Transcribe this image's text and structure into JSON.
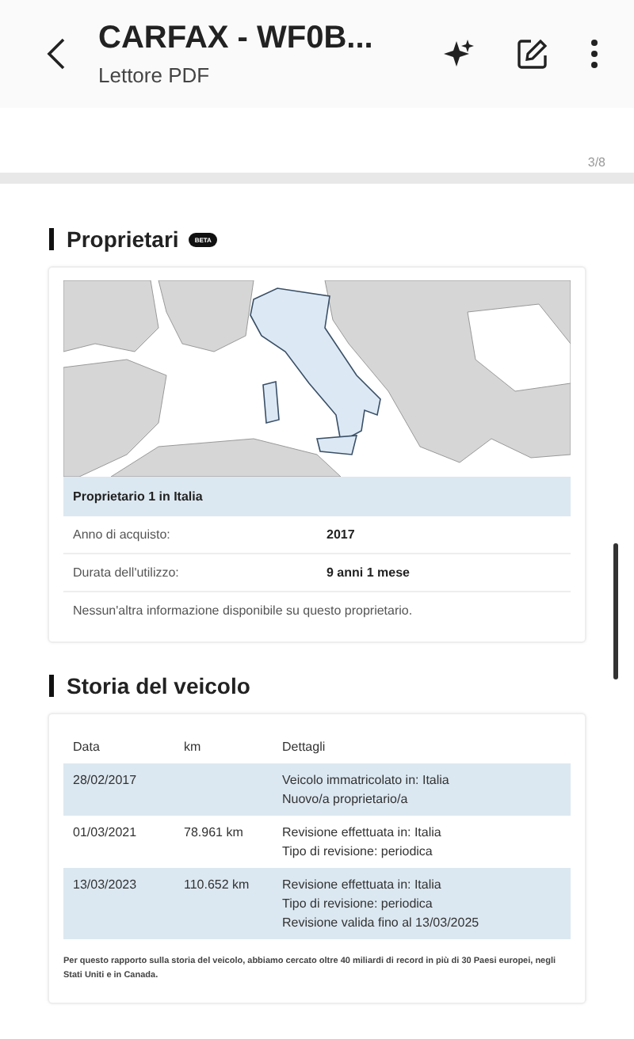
{
  "header": {
    "title": "CARFAX - WF0B...",
    "subtitle": "Lettore PDF"
  },
  "page_indicator": "3/8",
  "owners": {
    "title": "Proprietari",
    "badge": "BETA",
    "owner_heading": "Proprietario 1 in Italia",
    "rows": [
      {
        "label": "Anno di acquisto:",
        "value": "2017"
      },
      {
        "label": "Durata dell'utilizzo:",
        "value": "9 anni 1 mese"
      }
    ],
    "note": "Nessun'altra informazione disponibile su questo proprietario."
  },
  "history": {
    "title": "Storia del veicolo",
    "columns": [
      "Data",
      "km",
      "Dettagli"
    ],
    "rows": [
      {
        "date": "28/02/2017",
        "km": "",
        "details": [
          "Veicolo immatricolato in: Italia",
          "Nuovo/a proprietario/a"
        ]
      },
      {
        "date": "01/03/2021",
        "km": "78.961 km",
        "details": [
          "Revisione effettuata in: Italia",
          "Tipo di revisione: periodica"
        ]
      },
      {
        "date": "13/03/2023",
        "km": "110.652 km",
        "details": [
          "Revisione effettuata in: Italia",
          "Tipo di revisione: periodica",
          "Revisione valida fino al 13/03/2025"
        ]
      }
    ],
    "footnote": "Per questo rapporto sulla storia del veicolo, abbiamo cercato oltre 40 miliardi di record in più di 30 Paesi europei, negli Stati Uniti e in Canada."
  }
}
